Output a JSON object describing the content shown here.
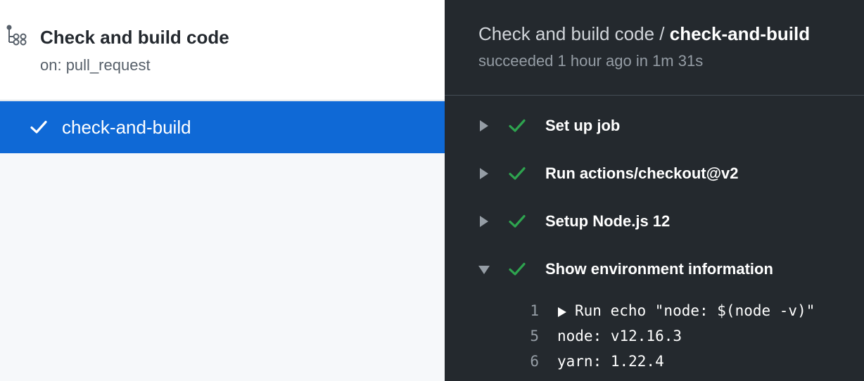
{
  "workflow": {
    "icon": "workflow-icon",
    "title": "Check and build code",
    "trigger": "on: pull_request"
  },
  "jobs": [
    {
      "label": "check-and-build",
      "status_icon": "check-icon",
      "selected": true
    }
  ],
  "run": {
    "workflow_name": "Check and build code",
    "separator": " / ",
    "job_name": "check-and-build",
    "summary": "succeeded 1 hour ago in 1m 31s"
  },
  "steps": [
    {
      "name": "Set up job",
      "expanded": false
    },
    {
      "name": "Run actions/checkout@v2",
      "expanded": false
    },
    {
      "name": "Setup Node.js 12",
      "expanded": false
    },
    {
      "name": "Show environment information",
      "expanded": true
    }
  ],
  "log_lines": [
    {
      "number": "1",
      "text": "Run echo \"node: $(node -v)\"",
      "collapsible": true
    },
    {
      "number": "5",
      "text": "node: v12.16.3",
      "collapsible": false
    },
    {
      "number": "6",
      "text": "yarn: 1.22.4",
      "collapsible": false
    }
  ],
  "colors": {
    "selected_bg": "#0f69d6",
    "success": "#2ea44f",
    "dark_bg": "#24292e"
  }
}
